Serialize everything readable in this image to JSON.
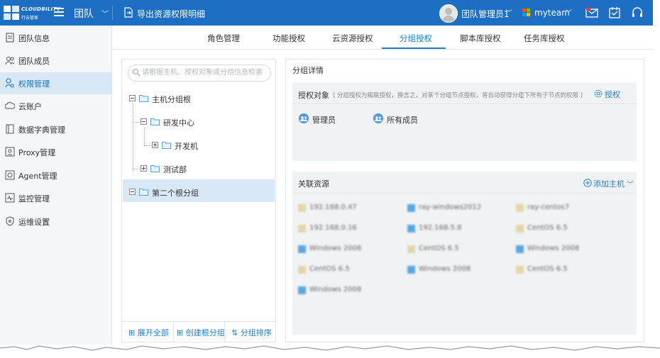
{
  "app": {
    "logo_text": "CLOUDBILITY",
    "logo_subtext": "行云管家",
    "section": "团队",
    "export_label": "导出资源权限明细",
    "user_name": "团队管理员1",
    "team_name": "myteam"
  },
  "sidebar": {
    "items": [
      {
        "label": "团队信息",
        "icon": "team-info-icon"
      },
      {
        "label": "团队成员",
        "icon": "members-icon"
      },
      {
        "label": "权限管理",
        "icon": "permission-icon",
        "active": true
      },
      {
        "label": "云账户",
        "icon": "cloud-account-icon"
      },
      {
        "label": "数据字典管理",
        "icon": "dictionary-icon"
      },
      {
        "label": "Proxy管理",
        "icon": "proxy-icon"
      },
      {
        "label": "Agent管理",
        "icon": "agent-icon"
      },
      {
        "label": "监控管理",
        "icon": "monitor-icon"
      },
      {
        "label": "运维设置",
        "icon": "ops-settings-icon"
      }
    ]
  },
  "tabs": [
    {
      "label": "角色管理"
    },
    {
      "label": "功能授权"
    },
    {
      "label": "云资源授权"
    },
    {
      "label": "分组授权",
      "active": true
    },
    {
      "label": "脚本库授权"
    },
    {
      "label": "任务库授权"
    }
  ],
  "tree": {
    "search_placeholder": "请根据主机、授权对象或分组信息检索",
    "nodes": [
      {
        "label": "主机分组根",
        "expanded": true
      },
      {
        "label": "研发中心",
        "expanded": true
      },
      {
        "label": "开发机",
        "expanded": false
      },
      {
        "label": "测试部",
        "expanded": false
      },
      {
        "label": "第二个根分组",
        "expanded": true,
        "selected": true
      }
    ],
    "footer": {
      "expand_all": "展开全部",
      "create_root": "创建根分组",
      "sort": "分组排序"
    }
  },
  "detail": {
    "title": "分组详情",
    "auth": {
      "title": "授权对象",
      "note": "( 分组授权为级联授权，换言之，对某个分组节点授权，将自动获得分组下所有子节点的权限 )",
      "button": "授权",
      "members": [
        {
          "label": "管理员"
        },
        {
          "label": "所有成员"
        }
      ]
    },
    "resources": {
      "title": "关联资源",
      "add_button": "添加主机",
      "items": [
        {
          "label": "192.168.0.47",
          "icon": "linux-host-icon"
        },
        {
          "label": "ray-windows2012",
          "icon": "windows-host-icon"
        },
        {
          "label": "ray-centos7",
          "icon": "linux-host-icon"
        },
        {
          "label": "192.168.0.16",
          "icon": "linux-host-icon"
        },
        {
          "label": "192.168.5.8",
          "icon": "windows-host-icon"
        },
        {
          "label": "CentOS 6.5",
          "icon": "linux-host-icon"
        },
        {
          "label": "Windows 2008",
          "icon": "windows-host-icon"
        },
        {
          "label": "CentOS 6.5",
          "icon": "linux-host-icon"
        },
        {
          "label": "Windows 2008",
          "icon": "windows-host-icon"
        },
        {
          "label": "CentOS 6.5",
          "icon": "linux-host-icon"
        },
        {
          "label": "Windows 2008",
          "icon": "windows-host-icon"
        },
        {
          "label": "CentOS 6.5",
          "icon": "linux-host-icon"
        },
        {
          "label": "Windows 2008",
          "icon": "windows-host-icon"
        }
      ]
    }
  },
  "colors": {
    "topbar": "#1d6fc3",
    "accent": "#1d7fd3",
    "sidebar_active": "#d9e8f7"
  }
}
